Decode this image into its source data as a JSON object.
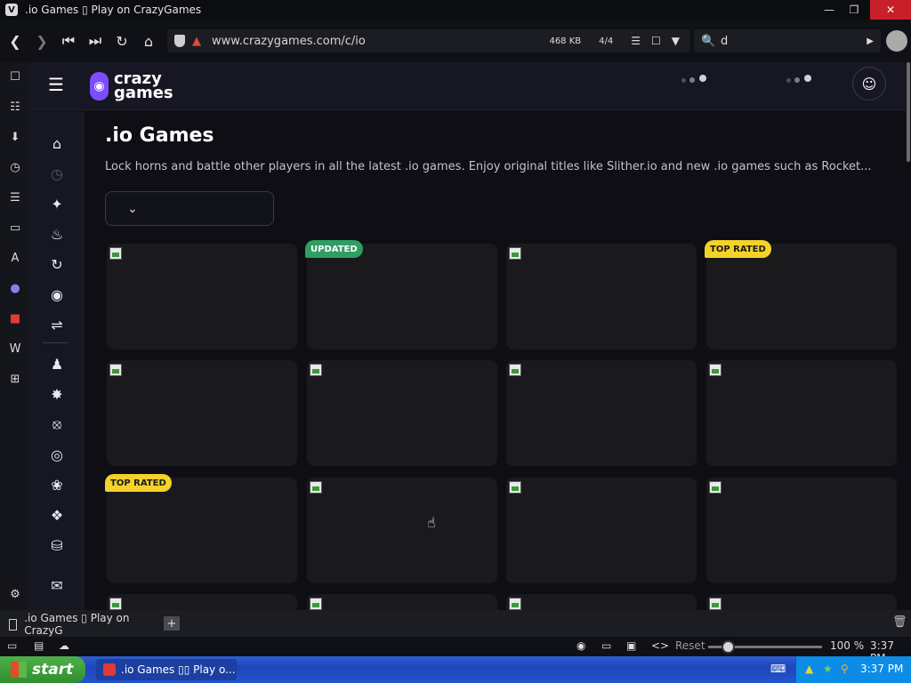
{
  "window": {
    "title": ".io Games ▯ Play on CrazyGames",
    "minimize": "—",
    "maximize": "❐",
    "close": "✕"
  },
  "browser": {
    "url": "www.crazygames.com/c/io",
    "page_size": "468 KB",
    "tab_count": "4/4",
    "search_value": "d",
    "search_prefix": "🔍"
  },
  "site": {
    "logo_text": "crazy games",
    "page_title": ".io Games",
    "description": "Lock horns and battle other players in all the latest .io games. Enjoy original titles like Slither.io and new .io games such as Rocket...",
    "sort_select_value": ""
  },
  "cards": [
    {
      "badge": ""
    },
    {
      "badge": "UPDATED"
    },
    {
      "badge": ""
    },
    {
      "badge": "TOP RATED"
    },
    {
      "badge": ""
    },
    {
      "badge": ""
    },
    {
      "badge": ""
    },
    {
      "badge": ""
    },
    {
      "badge": "TOP RATED"
    },
    {
      "badge": ""
    },
    {
      "badge": ""
    },
    {
      "badge": ""
    },
    {
      "badge": ""
    },
    {
      "badge": ""
    },
    {
      "badge": ""
    },
    {
      "badge": ""
    }
  ],
  "tabs": [
    {
      "label": ".io Games ▯ Play on CrazyG"
    }
  ],
  "statusbar": {
    "reset_label": "Reset",
    "zoom": "100 %",
    "zoom_fraction": 0.18,
    "time": "3:37 PM"
  },
  "taskbar": {
    "start_label": "start",
    "task_label": ".io Games ▯▯ Play o...",
    "clock": "3:37 PM"
  },
  "colors": {
    "updated_badge": "#2e9e62",
    "top_rated_badge": "#f5d22a",
    "logo_purple": "#7b4dff"
  }
}
